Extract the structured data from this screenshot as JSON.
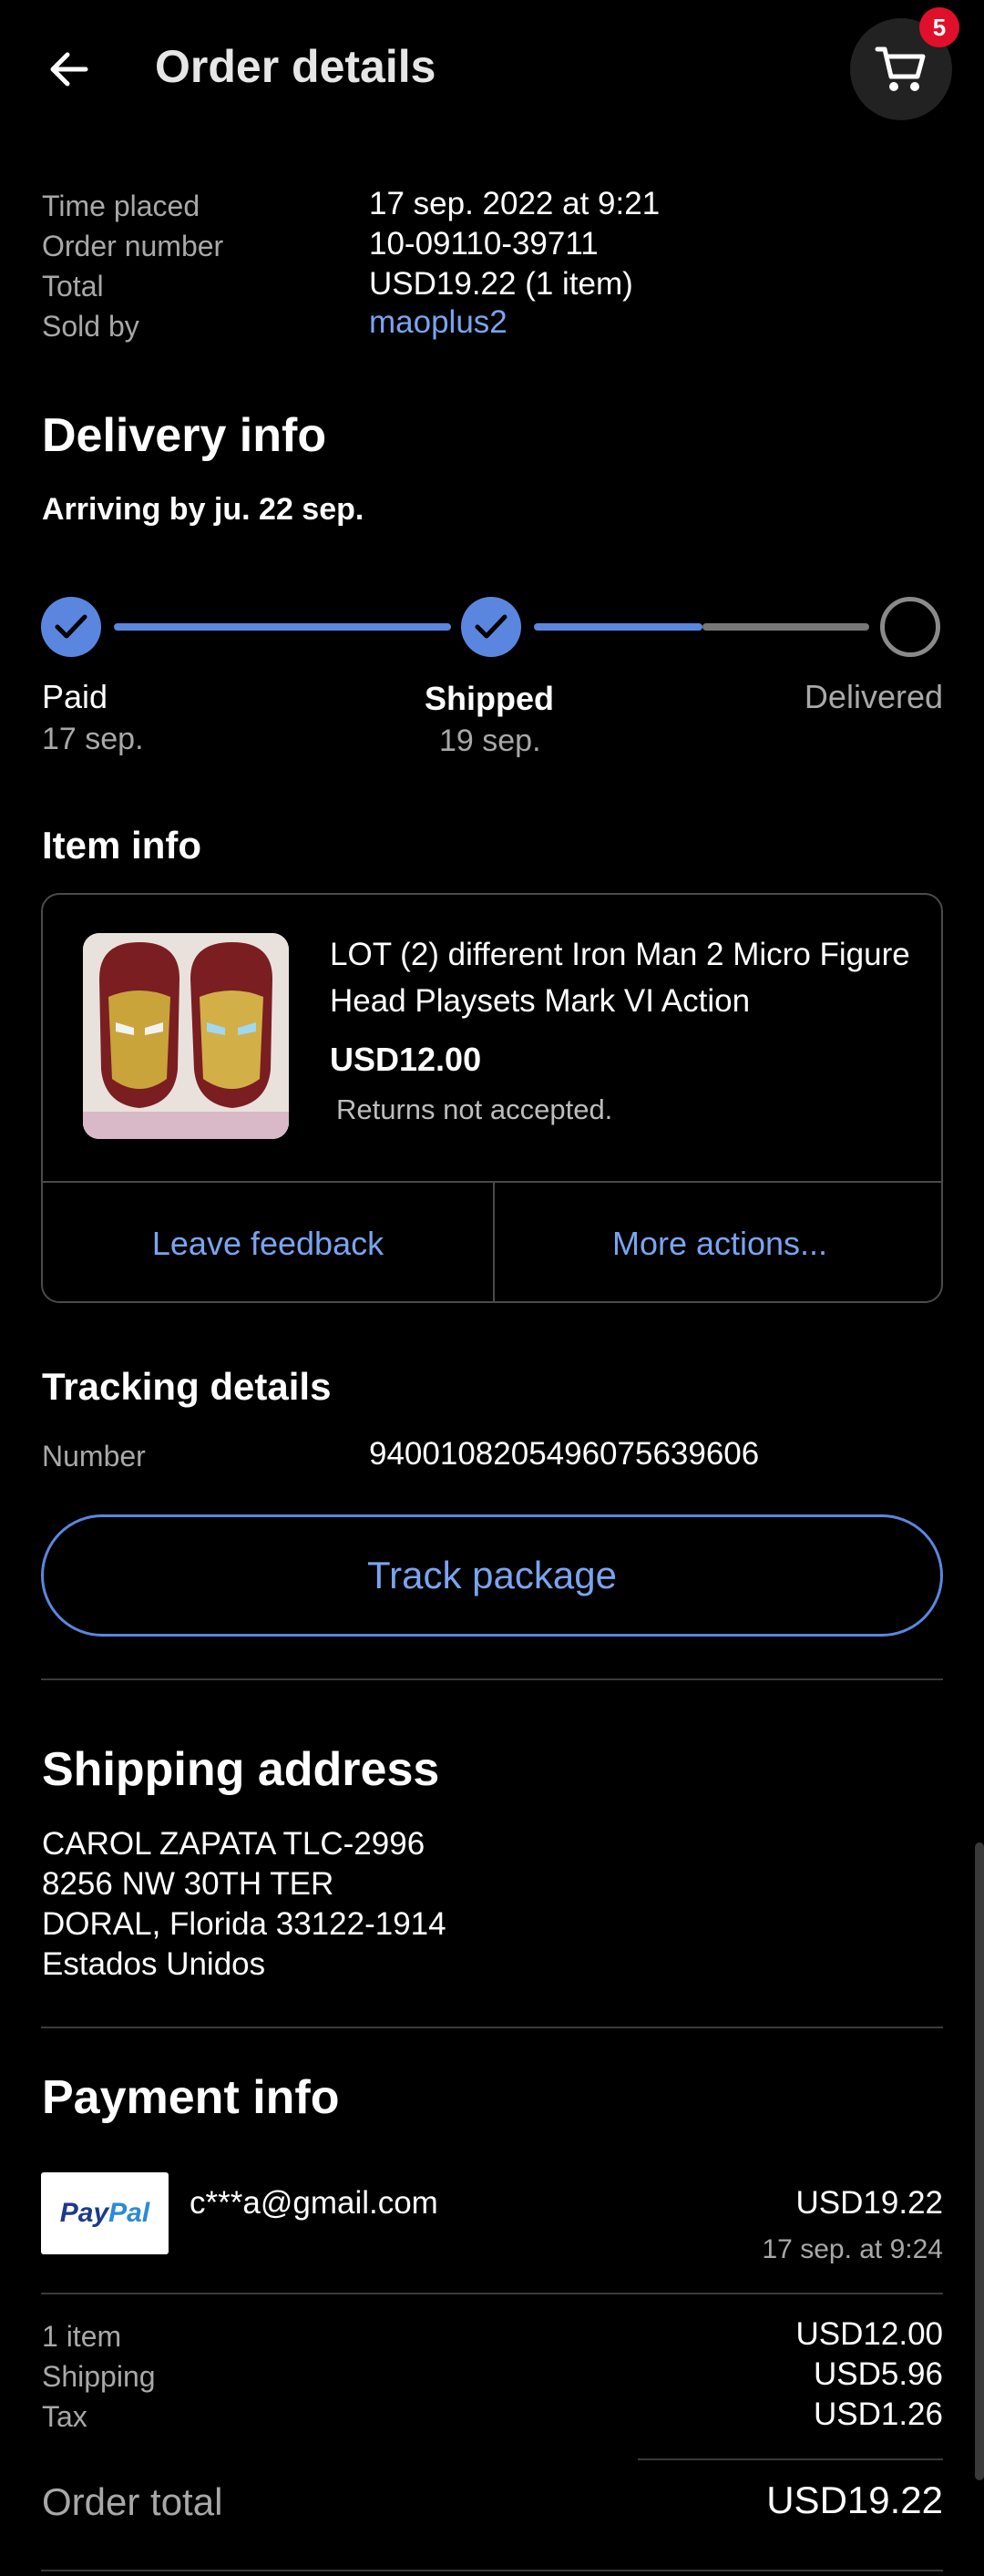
{
  "header": {
    "title": "Order details",
    "back_icon": "arrow-left-icon",
    "cart_icon": "cart-icon",
    "cart_count": "5"
  },
  "summary": {
    "time_placed_label": "Time placed",
    "time_placed_value": "17 sep. 2022 at 9:21",
    "order_number_label": "Order number",
    "order_number_value": "10-09110-39711",
    "total_label": "Total",
    "total_value": "USD19.22 (1 item)",
    "sold_by_label": "Sold by",
    "sold_by_value": "maoplus2"
  },
  "delivery": {
    "title": "Delivery info",
    "arriving": "Arriving by ju. 22 sep.",
    "steps": [
      {
        "label": "Paid",
        "date": "17 sep."
      },
      {
        "label": "Shipped",
        "date": "19 sep."
      },
      {
        "label": "Delivered",
        "date": ""
      }
    ]
  },
  "item": {
    "section_title": "Item info",
    "title": "LOT (2) different Iron Man 2 Micro Figure Head Playsets Mark VI Action",
    "price": "USD12.00",
    "returns": "Returns not accepted.",
    "leave_feedback": "Leave feedback",
    "more_actions": "More actions..."
  },
  "tracking": {
    "title": "Tracking details",
    "number_label": "Number",
    "number_value": "9400108205496075639606",
    "track_button": "Track package"
  },
  "shipping": {
    "title": "Shipping address",
    "lines": [
      "CAROL ZAPATA TLC-2996",
      "8256 NW 30TH TER",
      "DORAL, Florida 33122-1914",
      "Estados Unidos"
    ]
  },
  "payment": {
    "title": "Payment info",
    "method_logo_1": "Pay",
    "method_logo_2": "Pal",
    "email": "c***a@gmail.com",
    "amount": "USD19.22",
    "date": "17 sep. at 9:24",
    "items_label": "1 item",
    "items_value": "USD12.00",
    "shipping_label": "Shipping",
    "shipping_value": "USD5.96",
    "tax_label": "Tax",
    "tax_value": "USD1.26",
    "order_total_label": "Order total",
    "order_total_value": "USD19.22"
  },
  "colors": {
    "accent": "#5b86e0",
    "link": "#7aa4f0",
    "badge": "#e0102a"
  }
}
